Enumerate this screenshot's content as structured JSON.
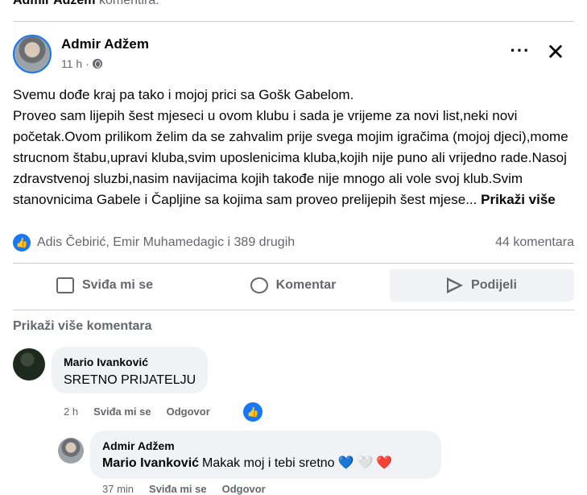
{
  "previous_comment": {
    "author": "Admir Adžem",
    "suffix": "komentira."
  },
  "post": {
    "author": "Admir Adžem",
    "time": "11 h",
    "paragraph1": "Svemu dođe kraj pa tako i mojoj prici sa Gošk Gabelom.",
    "paragraph2": "Proveo sam lijepih šest mjeseci u ovom klubu i sada je vrijeme za novi list,neki novi početak.Ovom prilikom želim da se zahvalim prije svega mojim igračima (mojoj djeci),mome strucnom štabu,upravi kluba,svim uposlenicima kluba,kojih nije puno ali vrijedno rade.Nasoj zdravstvenoj sluzbi,nasim navijacima kojih takođe nije mnogo ali vole svoj klub.Svim stanovnicima Gabele i Čapljine sa kojima sam proveo prelijepih šest mjese...",
    "see_more": "Prikaži više"
  },
  "reactions": {
    "icon": "like-icon",
    "summary": "Adis Čebirić, Emir Muhamedagic i 389 drugih",
    "comments_count": "44 komentara"
  },
  "actions": {
    "like": "Sviđa mi se",
    "comment": "Komentar",
    "share": "Podijeli"
  },
  "show_more_comments": "Prikaži više komentara",
  "comments": [
    {
      "author": "Mario Ivanković",
      "text": "SRETNO PRIJATELJU",
      "time": "2 h",
      "like": "Sviđa mi se",
      "reply": "Odgovor"
    },
    {
      "author": "Admir Adžem",
      "mention": "Mario Ivanković",
      "text": "Makak moj i tebi sretno",
      "hearts": [
        "💙",
        "🤍",
        "❤️"
      ],
      "time": "37 min",
      "like": "Sviđa mi se",
      "reply": "Odgovor"
    }
  ],
  "colors": {
    "accent": "#1877f2",
    "muted": "#65676b",
    "bubble": "#f0f2f5"
  }
}
